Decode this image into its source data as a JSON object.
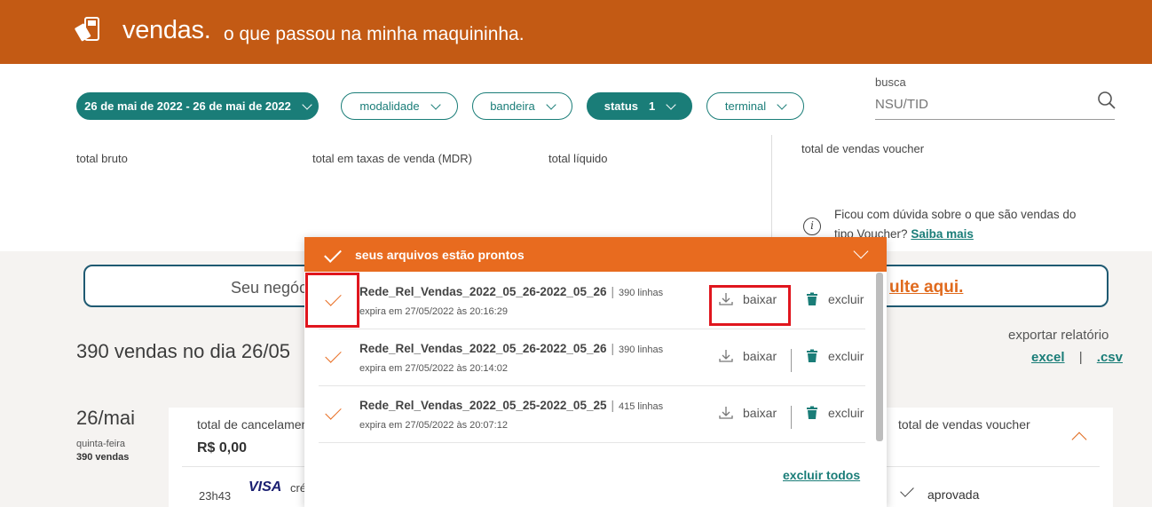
{
  "header": {
    "title": "vendas.",
    "subtitle": "o que passou na minha maquininha."
  },
  "filters": {
    "date_range": "26 de mai de 2022 - 26 de mai de 2022",
    "modalidade": "modalidade",
    "bandeira": "bandeira",
    "status": "status",
    "status_count": "1",
    "terminal": "terminal"
  },
  "search": {
    "label": "busca",
    "placeholder": "NSU/TID"
  },
  "summary": {
    "gross": "total bruto",
    "fees": "total em taxas de venda (MDR)",
    "net": "total líquido",
    "voucher": "total de vendas voucher",
    "info_text": "Ficou com dúvida sobre o que são vendas do tipo Voucher?",
    "info_link": "Saiba mais"
  },
  "banner": {
    "text": "Seu negóc",
    "link": "ulte aqui."
  },
  "sales": {
    "count_title": "390 vendas no dia 26/05",
    "export_label": "exportar relatório",
    "export_excel": "excel",
    "export_sep": "|",
    "export_csv": ".csv"
  },
  "day": {
    "date": "26/mai",
    "weekday": "quinta-feira",
    "count": "390 vendas",
    "cancel_label": "total de cancelament",
    "cancel_value": "R$ 0,00",
    "voucher_total": "total de vendas voucher",
    "time": "23h43",
    "brand": "VISA",
    "type": "cré",
    "status": "aprovada"
  },
  "files_panel": {
    "title": "seus arquivos estão prontos",
    "download_label": "baixar",
    "delete_label": "excluir",
    "delete_all": "excluir todos",
    "files": [
      {
        "name": "Rede_Rel_Vendas_2022_05_26-2022_05_26",
        "lines": "390 linhas",
        "expires": "expira em 27/05/2022 às 20:16:29"
      },
      {
        "name": "Rede_Rel_Vendas_2022_05_26-2022_05_26",
        "lines": "390 linhas",
        "expires": "expira em 27/05/2022 às 20:14:02"
      },
      {
        "name": "Rede_Rel_Vendas_2022_05_25-2022_05_25",
        "lines": "415 linhas",
        "expires": "expira em 27/05/2022 às 20:07:12"
      }
    ]
  }
}
